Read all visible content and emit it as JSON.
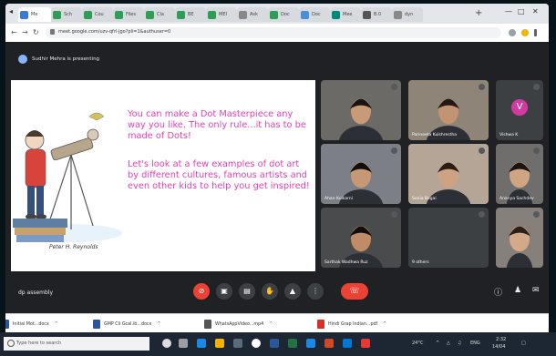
{
  "browser": {
    "tabs": [
      {
        "label": "Me",
        "color": "#3a7bd5"
      },
      {
        "label": "Sch",
        "color": "#2f9e55"
      },
      {
        "label": "Cou",
        "color": "#2f9e55"
      },
      {
        "label": "Files",
        "color": "#2f9e55"
      },
      {
        "label": "Cla",
        "color": "#2f9e55"
      },
      {
        "label": "BE",
        "color": "#2f9e55"
      },
      {
        "label": "MEI",
        "color": "#2f9e55"
      },
      {
        "label": "Ask",
        "color": "#888888"
      },
      {
        "label": "Doc",
        "color": "#2f9e55"
      },
      {
        "label": "Doc",
        "color": "#4a90d9"
      },
      {
        "label": "Mee",
        "color": "#00897b"
      },
      {
        "label": "B.0",
        "color": "#555555"
      },
      {
        "label": "dyn",
        "color": "#888888"
      }
    ],
    "new_tab_glyph": "+",
    "url": "meet.google.com/uzv-qfrl-jgo?pli=1&authuser=0"
  },
  "meet": {
    "presenting_text": "Sudhir Mehra is presenting",
    "meeting_name": "dp assembly",
    "slide": {
      "paragraph1": "You can make a Dot Masterpiece any way you like. The only rule...it has to be made of Dots!",
      "paragraph2": "Let's look at a few examples of dot art by different cultures, famous artists and even other kids to help you get inspired!",
      "signature": "Peter H. Reynolds"
    },
    "participants": [
      {
        "name": "",
        "avatar_letter": "",
        "bg": "#6b6a67",
        "skin": "#c89a78",
        "hair": "#1a1410"
      },
      {
        "name": "Parineeta Kulshrestha",
        "avatar_letter": "",
        "bg": "#8f8478",
        "skin": "#c29474",
        "hair": "#221914"
      },
      {
        "name": "Vishwa K",
        "avatar_letter": "V",
        "bg": "#3c4043",
        "skin": "",
        "hair": ""
      },
      {
        "name": "Ahan Kulkarni",
        "avatar_letter": "",
        "bg": "#7d7f86",
        "skin": "#c79875",
        "hair": "#120e0c"
      },
      {
        "name": "Sonia Bagai",
        "avatar_letter": "",
        "bg": "#b4a597",
        "skin": "#cfa283",
        "hair": "#2a1d16"
      },
      {
        "name": "Ananya Sachdev",
        "avatar_letter": "",
        "bg": "#6f6e6c",
        "skin": "#d0a584",
        "hair": "#1a1410"
      },
      {
        "name": "Sarthak Wadhwa Ruz",
        "avatar_letter": "",
        "bg": "#4a4b4d",
        "skin": "#c08b67",
        "hair": "#120d0b"
      },
      {
        "name": "9 others",
        "avatar_letter": "",
        "bg": "#3c4043",
        "skin": "",
        "hair": ""
      },
      {
        "name": "",
        "avatar_letter": "",
        "bg": "#87807a",
        "skin": "#d4a989",
        "hair": "#2b1e17"
      }
    ]
  },
  "downloads": [
    {
      "name": "Initial Mot...docx",
      "color": "#2b579a"
    },
    {
      "name": "GMP Cli Gcal.ib...docx",
      "color": "#2b579a"
    },
    {
      "name": "WhatsAppVideo...mp4",
      "color": "#555555"
    },
    {
      "name": "Hindi Grap Indian...pdf",
      "color": "#d93025"
    }
  ],
  "taskbar": {
    "search_placeholder": "Type here to search",
    "temperature": "24°C",
    "lang": "ENG",
    "time": "2:32",
    "date": "14/04"
  }
}
